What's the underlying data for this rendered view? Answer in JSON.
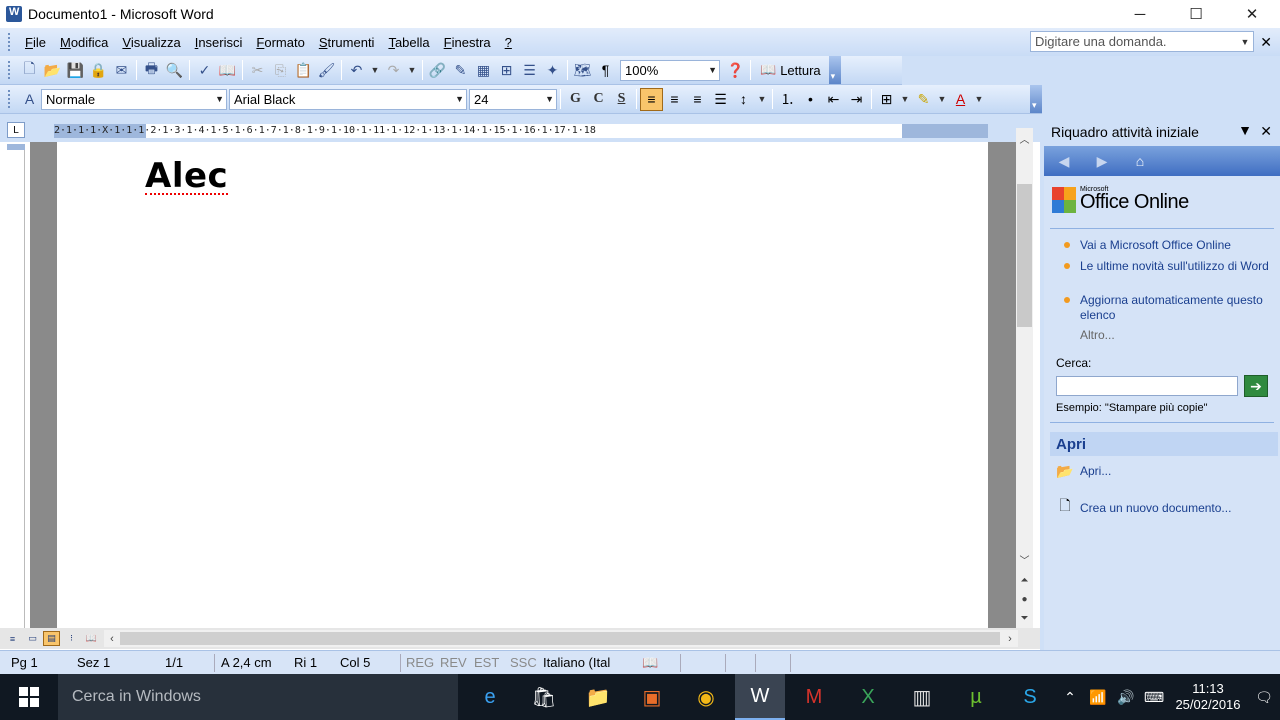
{
  "window": {
    "title": "Documento1 - Microsoft Word",
    "minimize": "─",
    "maximize": "☐",
    "close": "✕"
  },
  "menubar": {
    "items": [
      {
        "acc": "F",
        "rest": "ile"
      },
      {
        "acc": "M",
        "rest": "odifica"
      },
      {
        "acc": "V",
        "rest": "isualizza"
      },
      {
        "acc": "I",
        "rest": "nserisci"
      },
      {
        "acc": "F",
        "rest": "ormato"
      },
      {
        "acc": "S",
        "rest": "trumenti"
      },
      {
        "acc": "T",
        "rest": "abella"
      },
      {
        "acc": "F",
        "rest": "inestra"
      },
      {
        "acc": "?",
        "rest": ""
      }
    ],
    "ask_placeholder": "Digitare una domanda."
  },
  "standard_toolbar": {
    "zoom": "100%",
    "lettura": "Lettura"
  },
  "format_toolbar": {
    "style": "Normale",
    "font": "Arial Black",
    "size": "24",
    "bold": "G",
    "italic": "C",
    "underline": "S"
  },
  "ruler": {
    "text": "2·1·1·1·X·1·1·1·2·1·3·1·4·1·5·1·6·1·7·1·8·1·9·1·10·1·11·1·12·1·13·1·14·1·15·1·16·1·17·1·18"
  },
  "document": {
    "heading": "Alec"
  },
  "statusbar": {
    "page": "Pg 1",
    "section": "Sez 1",
    "pages": "1/1",
    "position": "A 2,4 cm",
    "line": "Ri 1",
    "col": "Col 5",
    "reg": "REG",
    "rev": "REV",
    "est": "EST",
    "ssc": "SSC",
    "language": "Italiano (Ital"
  },
  "taskpane": {
    "title": "Riquadro attività iniziale",
    "logo_small": "Microsoft",
    "logo": "Office Online",
    "links": [
      "Vai a Microsoft Office Online",
      "Le ultime novità sull'utilizzo di Word",
      "Aggiorna automaticamente questo elenco"
    ],
    "more": "Altro...",
    "search_label": "Cerca:",
    "example": "Esempio:  \"Stampare più copie\"",
    "open_section": "Apri",
    "open_link": "Apri...",
    "new_doc": "Crea un nuovo documento..."
  },
  "taskbar": {
    "search_placeholder": "Cerca in Windows",
    "time": "11:13",
    "date": "25/02/2016"
  },
  "colors": {
    "office_blue": "#cfe0f7",
    "taskbar": "#101822",
    "link": "#1a3f8f",
    "bullet": "#f29a1f"
  }
}
